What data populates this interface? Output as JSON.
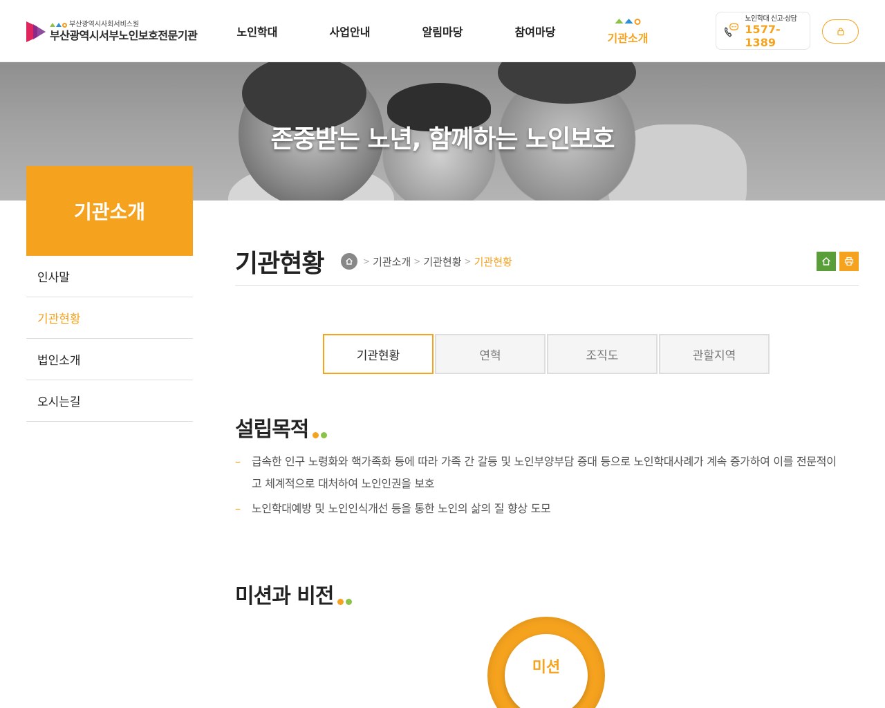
{
  "header": {
    "logo_sub": "부산광역시사회서비스원",
    "logo_main": "부산광역시서부노인보호전문기관",
    "nav": [
      {
        "label": "노인학대"
      },
      {
        "label": "사업안내"
      },
      {
        "label": "알림마당"
      },
      {
        "label": "참여마당"
      },
      {
        "label": "기관소개"
      }
    ],
    "report_label": "노인학대 신고·상담",
    "report_phone": "1577-1389"
  },
  "hero": {
    "title": "존중받는 노년, 함께하는 노인보호"
  },
  "sidebar": {
    "title": "기관소개",
    "items": [
      {
        "label": "인사말"
      },
      {
        "label": "기관현황"
      },
      {
        "label": "법인소개"
      },
      {
        "label": "오시는길"
      }
    ]
  },
  "content": {
    "page_title": "기관현황",
    "breadcrumb": [
      "기관소개",
      "기관현황",
      "기관현황"
    ],
    "tabs": [
      {
        "label": "기관현황"
      },
      {
        "label": "연혁"
      },
      {
        "label": "조직도"
      },
      {
        "label": "관할지역"
      }
    ],
    "section1_title": "설립목적",
    "purpose": [
      "급속한 인구 노령화와 핵가족화 등에 따라 가족 간 갈등 및 노인부양부담 증대 등으로 노인학대사례가 계속 증가하여 이를 전문적이고 체계적으로 대처하여 노인인권을 보호",
      "노인학대예방 및 노인인식개선 등을 통한 노인의 삶의 질 향상 도모"
    ],
    "section2_title": "미션과 비전",
    "mission_label": "미션"
  },
  "colors": {
    "accent": "#f5a21e",
    "green": "#5a9e3a",
    "light_green": "#8bc34a",
    "blue": "#2b8fd8"
  }
}
